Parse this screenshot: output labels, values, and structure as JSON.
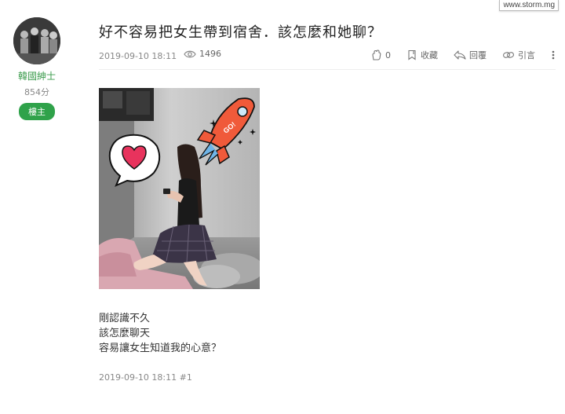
{
  "watermark": "www.storm.mg",
  "author": {
    "name": "韓國紳士",
    "points": "854分",
    "role": "樓主"
  },
  "post": {
    "title": "好不容易把女生帶到宿舍．該怎麼和她聊？",
    "date": "2019-09-10 18:11",
    "views": "1496",
    "likes": "0",
    "actions": {
      "favorite": "收藏",
      "reply": "回覆",
      "quote": "引言"
    },
    "body_lines": [
      "剛認識不久",
      "該怎麼聊天",
      "容易讓女生知道我的心意？"
    ],
    "footer": "2019-09-10 18:11 #1",
    "image_text": "GO!"
  },
  "icons": {
    "views": "eye-icon",
    "like": "clap-hand-icon",
    "favorite": "bookmark-icon",
    "reply": "reply-arrow-icon",
    "quote": "link-icon",
    "more": "vertical-dots-icon",
    "sticker_heart": "heart-icon",
    "sticker_rocket": "rocket-icon"
  },
  "colors": {
    "accent_green": "#2fa24a",
    "author_green": "#3d9c4e",
    "heart": "#e8335d",
    "rocket": "#f05a3a"
  }
}
